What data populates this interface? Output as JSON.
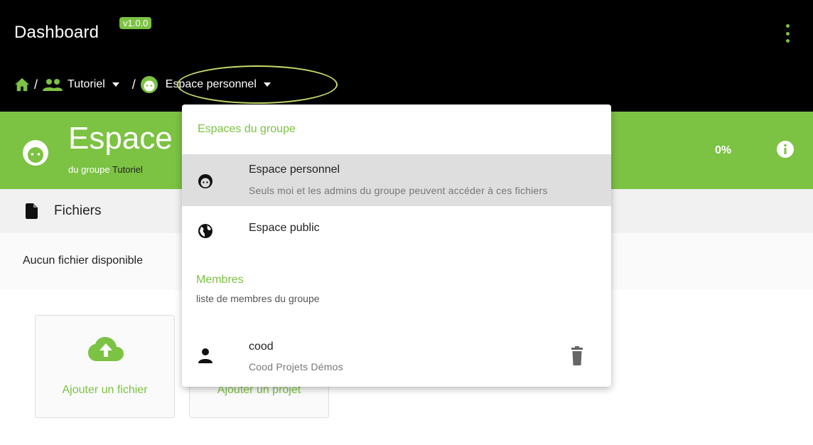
{
  "header": {
    "title": "Dashboard",
    "version": "v1.0.0"
  },
  "breadcrumb": {
    "group": "Tutoriel",
    "current": "Espace personnel"
  },
  "space": {
    "title": "Espace",
    "subtitle_prefix": "du groupe",
    "group": "Tutoriel",
    "percent": "0%"
  },
  "files": {
    "label": "Fichiers",
    "empty": "Aucun fichier disponible"
  },
  "cards": {
    "add_file": "Ajouter un fichier",
    "add_project": "Ajouter un projet"
  },
  "menu": {
    "heading": "Espaces du groupe",
    "items": [
      {
        "label": "Espace personnel",
        "sub": "Seuls moi et les admins du groupe peuvent accéder à ces fichiers"
      },
      {
        "label": "Espace public"
      }
    ],
    "members_heading": "Membres",
    "members_sub": "liste de membres du groupe",
    "members": [
      {
        "name": "cood",
        "sub": "Cood Projets Démos"
      }
    ]
  },
  "colors": {
    "accent": "#7cc243",
    "topbar": "#000000"
  }
}
